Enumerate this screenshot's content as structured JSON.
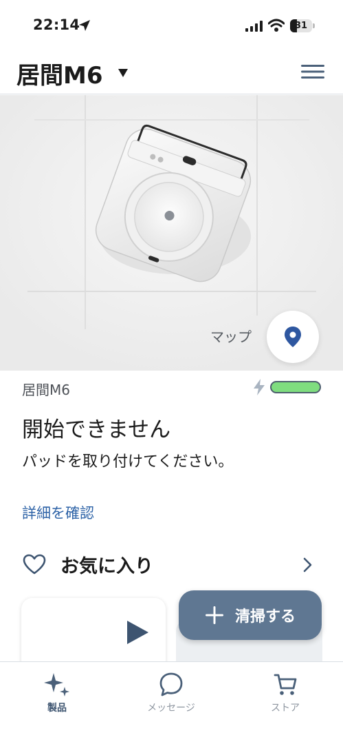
{
  "status_bar": {
    "time": "22:14",
    "battery_level": "31"
  },
  "header": {
    "title": "居間M6",
    "menu_icon": "hamburger-menu-icon"
  },
  "hero": {
    "map_label": "マップ",
    "map_icon": "location-pin-icon"
  },
  "robot": {
    "name": "居間M6",
    "charging_icon": "bolt-icon",
    "battery_color": "#7fdd7f",
    "status_title": "開始できません",
    "status_message": "パッドを取り付けてください。",
    "details_link": "詳細を確認"
  },
  "favorites": {
    "label": "お気に入り",
    "icon": "heart-icon"
  },
  "actions": {
    "clean_label": "清掃する"
  },
  "tabs": [
    {
      "label": "製品",
      "icon": "sparkle-icon",
      "active": true
    },
    {
      "label": "メッセージ",
      "icon": "chat-bubble-icon",
      "active": false
    },
    {
      "label": "ストア",
      "icon": "cart-icon",
      "active": false
    }
  ],
  "colors": {
    "accent": "#2e63a7",
    "clean_button": "#5f7792",
    "tab_active": "#3d5470",
    "tab_inactive": "#8e96a0"
  }
}
